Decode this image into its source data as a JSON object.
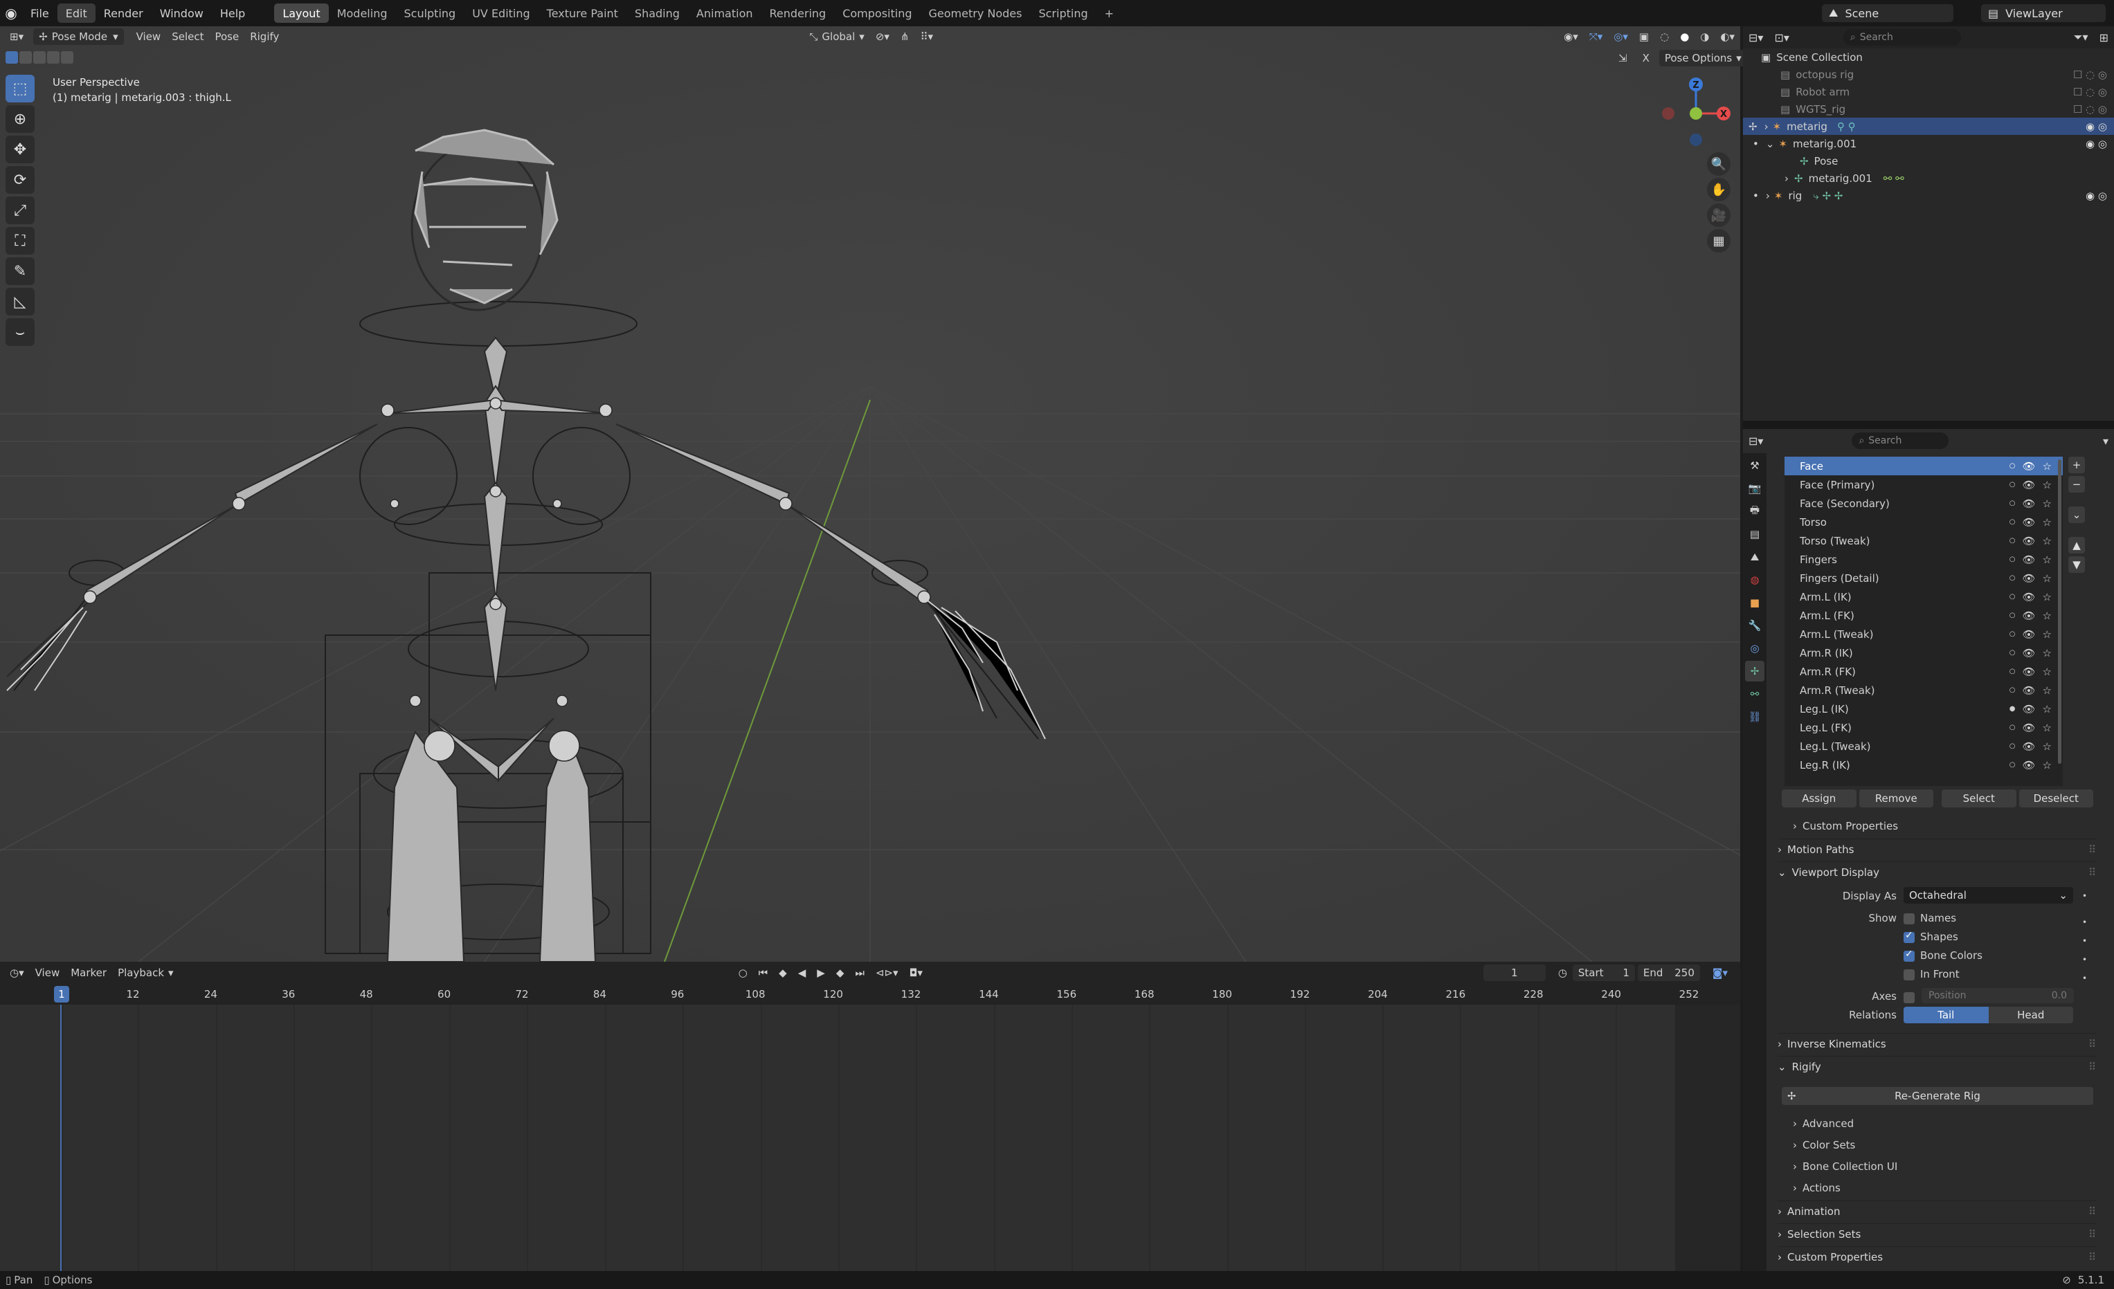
{
  "topbar": {
    "menus": [
      "File",
      "Edit",
      "Render",
      "Window",
      "Help"
    ],
    "workspaces": [
      "Layout",
      "Modeling",
      "Sculpting",
      "UV Editing",
      "Texture Paint",
      "Shading",
      "Animation",
      "Rendering",
      "Compositing",
      "Geometry Nodes",
      "Scripting"
    ],
    "add_tab": "+",
    "scene": "Scene",
    "view_layer": "ViewLayer"
  },
  "viewport": {
    "mode": "Pose Mode",
    "menus": [
      "View",
      "Select",
      "Pose",
      "Rigify"
    ],
    "orientation": "Global",
    "pose_options": "Pose Options",
    "overlay_title": "User Perspective",
    "overlay_subtitle": "(1) metarig | metarig.003 : thigh.L",
    "gizmo_axes": {
      "x": "X",
      "y": "Y",
      "z": "Z"
    },
    "axis_colors": {
      "x": "#e64b4b",
      "y": "#8fc03f",
      "z": "#3a7ad8"
    }
  },
  "timeline": {
    "menus": [
      "View",
      "Marker",
      "Playback"
    ],
    "current_frame": "1",
    "start_label": "Start",
    "start_value": "1",
    "end_label": "End",
    "end_value": "250",
    "ruler_frames": [
      "12",
      "24",
      "36",
      "48",
      "60",
      "72",
      "84",
      "96",
      "108",
      "120",
      "132",
      "144",
      "156",
      "168",
      "180",
      "192",
      "204",
      "216",
      "228",
      "240",
      "252"
    ],
    "playhead": "1"
  },
  "statusbar": {
    "left_items": [
      "Pan",
      "Options"
    ],
    "version": "5.1.1"
  },
  "outliner": {
    "search_placeholder": "Search",
    "root": "Scene Collection",
    "items": [
      {
        "label": "octopus rig",
        "dim": true
      },
      {
        "label": "Robot arm",
        "dim": true
      },
      {
        "label": "WGTS_rig",
        "dim": true
      },
      {
        "label": "metarig",
        "selected": true
      },
      {
        "label": "metarig.001"
      },
      {
        "label": "Pose",
        "child": true
      },
      {
        "label": "metarig.001",
        "child": true
      },
      {
        "label": "rig"
      }
    ]
  },
  "properties": {
    "search_placeholder": "Search",
    "bone_collections": [
      "Face",
      "Face (Primary)",
      "Face (Secondary)",
      "Torso",
      "Torso (Tweak)",
      "Fingers",
      "Fingers (Detail)",
      "Arm.L (IK)",
      "Arm.L (FK)",
      "Arm.L (Tweak)",
      "Arm.R (IK)",
      "Arm.R (FK)",
      "Arm.R (Tweak)",
      "Leg.L (IK)",
      "Leg.L (FK)",
      "Leg.L (Tweak)",
      "Leg.R (IK)"
    ],
    "buttons": {
      "assign": "Assign",
      "remove": "Remove",
      "select": "Select",
      "deselect": "Deselect"
    },
    "sections": {
      "custom_properties_sub": "Custom Properties",
      "motion_paths": "Motion Paths",
      "viewport_display": "Viewport Display",
      "inverse_kinematics": "Inverse Kinematics",
      "rigify": "Rigify",
      "animation": "Animation",
      "selection_sets": "Selection Sets",
      "custom_properties": "Custom Properties"
    },
    "viewport_display": {
      "display_as_label": "Display As",
      "display_as_value": "Octahedral",
      "show_label": "Show",
      "names": "Names",
      "shapes": "Shapes",
      "bone_colors": "Bone Colors",
      "in_front": "In Front",
      "axes_label": "Axes",
      "position_label": "Position",
      "position_value": "0.0",
      "relations_label": "Relations",
      "tail": "Tail",
      "head": "Head"
    },
    "rigify": {
      "regenerate": "Re-Generate Rig",
      "advanced": "Advanced",
      "color_sets": "Color Sets",
      "bone_collection_ui": "Bone Collection UI",
      "actions": "Actions"
    }
  },
  "colors": {
    "accent": "#4772b3",
    "selection": "#334d80"
  }
}
